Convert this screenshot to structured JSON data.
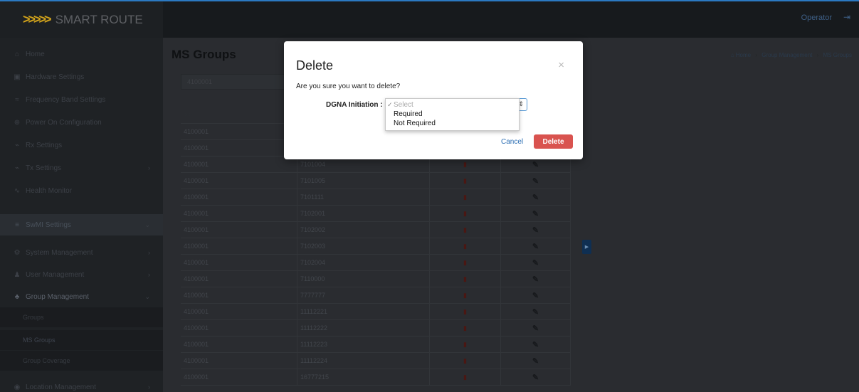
{
  "brand": {
    "arrows": ">>>>>",
    "name": "SMART ROUTE"
  },
  "topbar": {
    "user": "Operator",
    "logout_icon": "sign-out-icon"
  },
  "sidebar": {
    "items": [
      {
        "label": "Home",
        "icon": "home-icon"
      },
      {
        "label": "Hardware Settings",
        "icon": "hardware-icon"
      },
      {
        "label": "Frequency Band Settings",
        "icon": "frequency-icon"
      },
      {
        "label": "Power On Configuration",
        "icon": "power-icon"
      },
      {
        "label": "Rx Settings",
        "icon": "rx-icon"
      },
      {
        "label": "Tx Settings",
        "icon": "tx-icon"
      },
      {
        "label": "Health Monitor",
        "icon": "pulse-icon"
      },
      {
        "label": "SwMI Settings",
        "icon": "list-icon"
      },
      {
        "label": "System Management",
        "icon": "gears-icon"
      },
      {
        "label": "User Management",
        "icon": "user-icon"
      },
      {
        "label": "Group Management",
        "icon": "users-icon"
      },
      {
        "label": "Location Management",
        "icon": "location-icon"
      }
    ],
    "subitems": [
      {
        "label": "Groups"
      },
      {
        "label": "MS Groups"
      },
      {
        "label": "Group Coverage"
      }
    ]
  },
  "main": {
    "title": "MS Groups",
    "breadcrumb": [
      "Home",
      "Group Management",
      "MS Groups"
    ],
    "ssi_input_value": "4100001",
    "table": {
      "header_ssi": "SSI",
      "rows": [
        {
          "ssi": "4100001",
          "group": ""
        },
        {
          "ssi": "4100001",
          "group": ""
        },
        {
          "ssi": "4100001",
          "group": "7101004"
        },
        {
          "ssi": "4100001",
          "group": "7101005"
        },
        {
          "ssi": "4100001",
          "group": "7101111"
        },
        {
          "ssi": "4100001",
          "group": "7102001"
        },
        {
          "ssi": "4100001",
          "group": "7102002"
        },
        {
          "ssi": "4100001",
          "group": "7102003"
        },
        {
          "ssi": "4100001",
          "group": "7102004"
        },
        {
          "ssi": "4100001",
          "group": "7110000"
        },
        {
          "ssi": "4100001",
          "group": "7777777"
        },
        {
          "ssi": "4100001",
          "group": "11112221"
        },
        {
          "ssi": "4100001",
          "group": "11112222"
        },
        {
          "ssi": "4100001",
          "group": "11112223"
        },
        {
          "ssi": "4100001",
          "group": "11112224"
        },
        {
          "ssi": "4100001",
          "group": "16777215"
        }
      ]
    }
  },
  "modal": {
    "title": "Delete",
    "close": "×",
    "question": "Are you sure you want to delete?",
    "dgna_label": "DGNA Initiation :",
    "options": [
      "Select",
      "Required",
      "Not Required"
    ],
    "selected_option": "Select",
    "cancel_label": "Cancel",
    "delete_label": "Delete"
  }
}
